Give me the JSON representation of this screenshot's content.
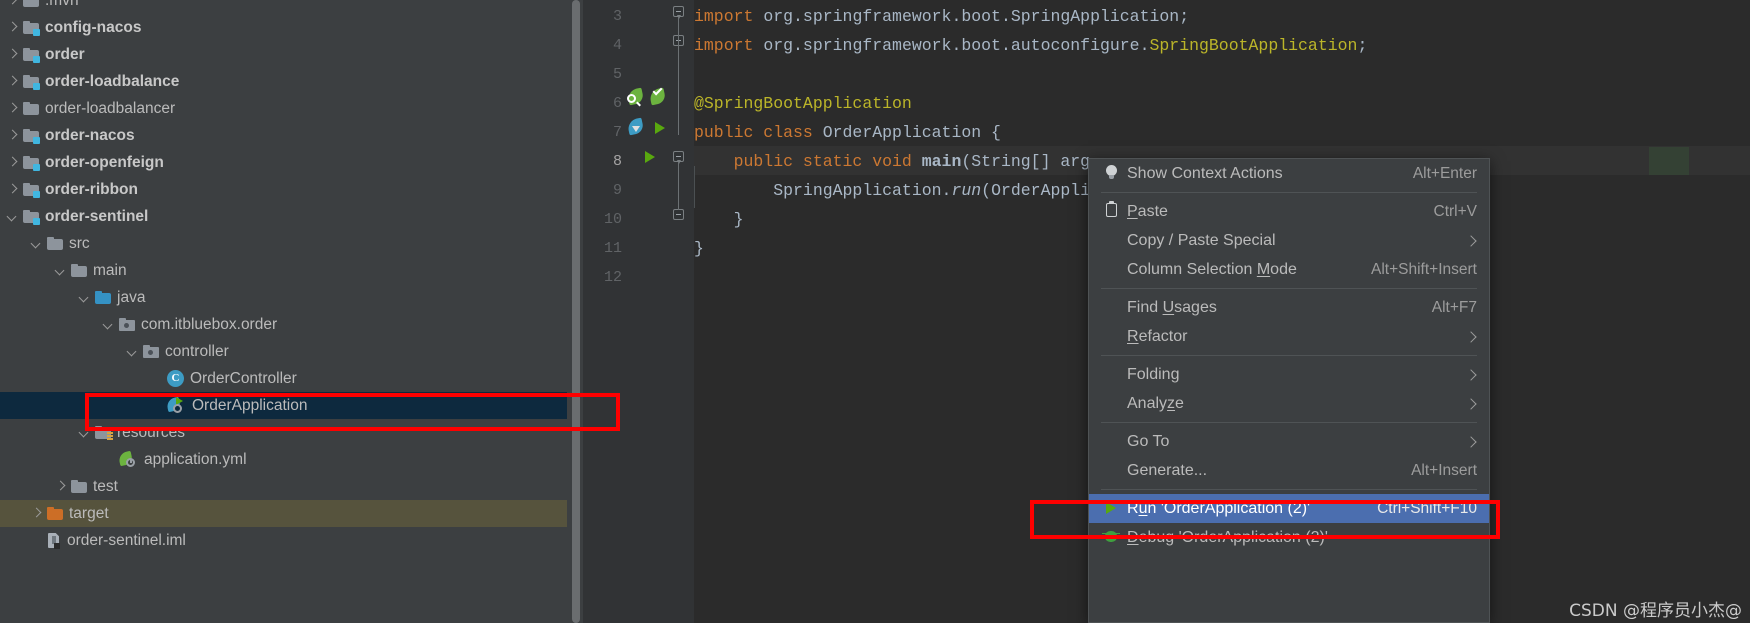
{
  "project_tree": {
    "rows": [
      {
        "label": ".mvn",
        "indent": 0,
        "arrow": "right",
        "icon": "folder-plain",
        "bold": false
      },
      {
        "label": "config-nacos",
        "indent": 0,
        "arrow": "right",
        "icon": "folder-module",
        "bold": true
      },
      {
        "label": "order",
        "indent": 0,
        "arrow": "right",
        "icon": "folder-module",
        "bold": true
      },
      {
        "label": "order-loadbalance",
        "indent": 0,
        "arrow": "right",
        "icon": "folder-module",
        "bold": true
      },
      {
        "label": "order-loadbalancer",
        "indent": 0,
        "arrow": "right",
        "icon": "folder-plain",
        "bold": false
      },
      {
        "label": "order-nacos",
        "indent": 0,
        "arrow": "right",
        "icon": "folder-module",
        "bold": true
      },
      {
        "label": "order-openfeign",
        "indent": 0,
        "arrow": "right",
        "icon": "folder-module",
        "bold": true
      },
      {
        "label": "order-ribbon",
        "indent": 0,
        "arrow": "right",
        "icon": "folder-module",
        "bold": true
      },
      {
        "label": "order-sentinel",
        "indent": 0,
        "arrow": "down",
        "icon": "folder-module",
        "bold": true
      },
      {
        "label": "src",
        "indent": 1,
        "arrow": "down",
        "icon": "folder-plain",
        "bold": false
      },
      {
        "label": "main",
        "indent": 2,
        "arrow": "down",
        "icon": "folder-plain",
        "bold": false
      },
      {
        "label": "java",
        "indent": 3,
        "arrow": "down",
        "icon": "folder-source",
        "bold": false
      },
      {
        "label": "com.itbluebox.order",
        "indent": 4,
        "arrow": "down",
        "icon": "package",
        "bold": false
      },
      {
        "label": "controller",
        "indent": 5,
        "arrow": "down",
        "icon": "package",
        "bold": false
      },
      {
        "label": "OrderController",
        "indent": 6,
        "arrow": "none",
        "icon": "java-class",
        "bold": false
      },
      {
        "label": "OrderApplication",
        "indent": 6,
        "arrow": "none",
        "icon": "spring-boot-run",
        "bold": false,
        "selected": true
      },
      {
        "label": "resources",
        "indent": 3,
        "arrow": "down",
        "icon": "folder-resources",
        "bold": false
      },
      {
        "label": "application.yml",
        "indent": 4,
        "arrow": "none",
        "icon": "spring-yaml",
        "bold": false
      },
      {
        "label": "test",
        "indent": 2,
        "arrow": "right",
        "icon": "folder-plain",
        "bold": false
      },
      {
        "label": "target",
        "indent": 1,
        "arrow": "right",
        "icon": "folder-excluded",
        "bold": false,
        "excluded": true
      },
      {
        "label": "order-sentinel.iml",
        "indent": 1,
        "arrow": "none",
        "icon": "iml-file",
        "bold": false
      }
    ]
  },
  "editor": {
    "line_numbers": [
      "3",
      "4",
      "5",
      "6",
      "7",
      "8",
      "9",
      "10",
      "11",
      "12"
    ],
    "current_line": "8",
    "lines": [
      {
        "n": "3",
        "tokens": [
          {
            "t": "import",
            "c": "k"
          },
          {
            "t": " org.springframework.boot.SpringApplication;",
            "c": "p"
          }
        ]
      },
      {
        "n": "4",
        "tokens": [
          {
            "t": "import",
            "c": "k"
          },
          {
            "t": " org.springframework.boot.autoconfigure.",
            "c": "p"
          },
          {
            "t": "SpringBootApplication",
            "c": "ann"
          },
          {
            "t": ";",
            "c": "p"
          }
        ]
      },
      {
        "n": "5",
        "tokens": []
      },
      {
        "n": "6",
        "tokens": [
          {
            "t": "@SpringBootApplication",
            "c": "ann"
          }
        ]
      },
      {
        "n": "7",
        "tokens": [
          {
            "t": "public class",
            "c": "k"
          },
          {
            "t": " OrderApplication {",
            "c": "p"
          }
        ]
      },
      {
        "n": "8",
        "tokens": [
          {
            "t": "    public static void",
            "c": "k"
          },
          {
            "t": " ",
            "c": "p"
          },
          {
            "t": "main",
            "c": "fnb"
          },
          {
            "t": "(String[] arg",
            "c": "p"
          }
        ]
      },
      {
        "n": "9",
        "tokens": [
          {
            "t": "        SpringApplication.",
            "c": "p"
          },
          {
            "t": "run",
            "c": "it"
          },
          {
            "t": "(OrderAppli",
            "c": "p"
          }
        ]
      },
      {
        "n": "10",
        "tokens": [
          {
            "t": "    }",
            "c": "p"
          }
        ]
      },
      {
        "n": "11",
        "tokens": [
          {
            "t": "}",
            "c": "p"
          }
        ]
      },
      {
        "n": "12",
        "tokens": []
      }
    ],
    "gutter_icons": {
      "line6_bean_search": "spring-bean-search-icon",
      "line6_bean_check": "spring-bean-check-icon",
      "line7_bean": "spring-boot-bean-icon",
      "line7_run": "run-gutter-icon",
      "line8_run": "run-gutter-icon"
    }
  },
  "context_menu": {
    "items": [
      {
        "icon": "lightbulb-icon",
        "label": "Show Context Actions",
        "mnemonic": "",
        "shortcut": "Alt+Enter",
        "arrow": false
      },
      {
        "sep": true
      },
      {
        "icon": "clipboard-icon",
        "label": "Paste",
        "mnemonic": "P",
        "shortcut": "Ctrl+V",
        "arrow": false
      },
      {
        "icon": "",
        "label": "Copy / Paste Special",
        "mnemonic": "",
        "shortcut": "",
        "arrow": true
      },
      {
        "icon": "",
        "label": "Column Selection Mode",
        "mnemonic": "M",
        "shortcut": "Alt+Shift+Insert",
        "arrow": false
      },
      {
        "sep": true
      },
      {
        "icon": "",
        "label": "Find Usages",
        "mnemonic": "U",
        "shortcut": "Alt+F7",
        "arrow": false
      },
      {
        "icon": "",
        "label": "Refactor",
        "mnemonic": "R",
        "shortcut": "",
        "arrow": true
      },
      {
        "sep": true
      },
      {
        "icon": "",
        "label": "Folding",
        "mnemonic": "",
        "shortcut": "",
        "arrow": true
      },
      {
        "icon": "",
        "label": "Analyze",
        "mnemonic": "z",
        "shortcut": "",
        "arrow": true
      },
      {
        "sep": true
      },
      {
        "icon": "",
        "label": "Go To",
        "mnemonic": "",
        "shortcut": "",
        "arrow": true
      },
      {
        "icon": "",
        "label": "Generate...",
        "mnemonic": "",
        "shortcut": "Alt+Insert",
        "arrow": false
      },
      {
        "sep": true
      },
      {
        "icon": "run-icon",
        "label": "Run 'OrderApplication (2)'",
        "mnemonic": "u",
        "shortcut": "Ctrl+Shift+F10",
        "arrow": false,
        "highlighted": true
      },
      {
        "icon": "debug-icon",
        "label": "Debug 'OrderApplication (2)'",
        "mnemonic": "D",
        "shortcut": "",
        "arrow": false
      }
    ]
  },
  "annotations": {
    "highlight_color": "#fe0000",
    "boxes": [
      {
        "name": "tree-orderapplication-highlight"
      },
      {
        "name": "menu-run-orderapplication-highlight"
      }
    ]
  },
  "watermark": {
    "text": "CSDN @程序员小杰@"
  }
}
